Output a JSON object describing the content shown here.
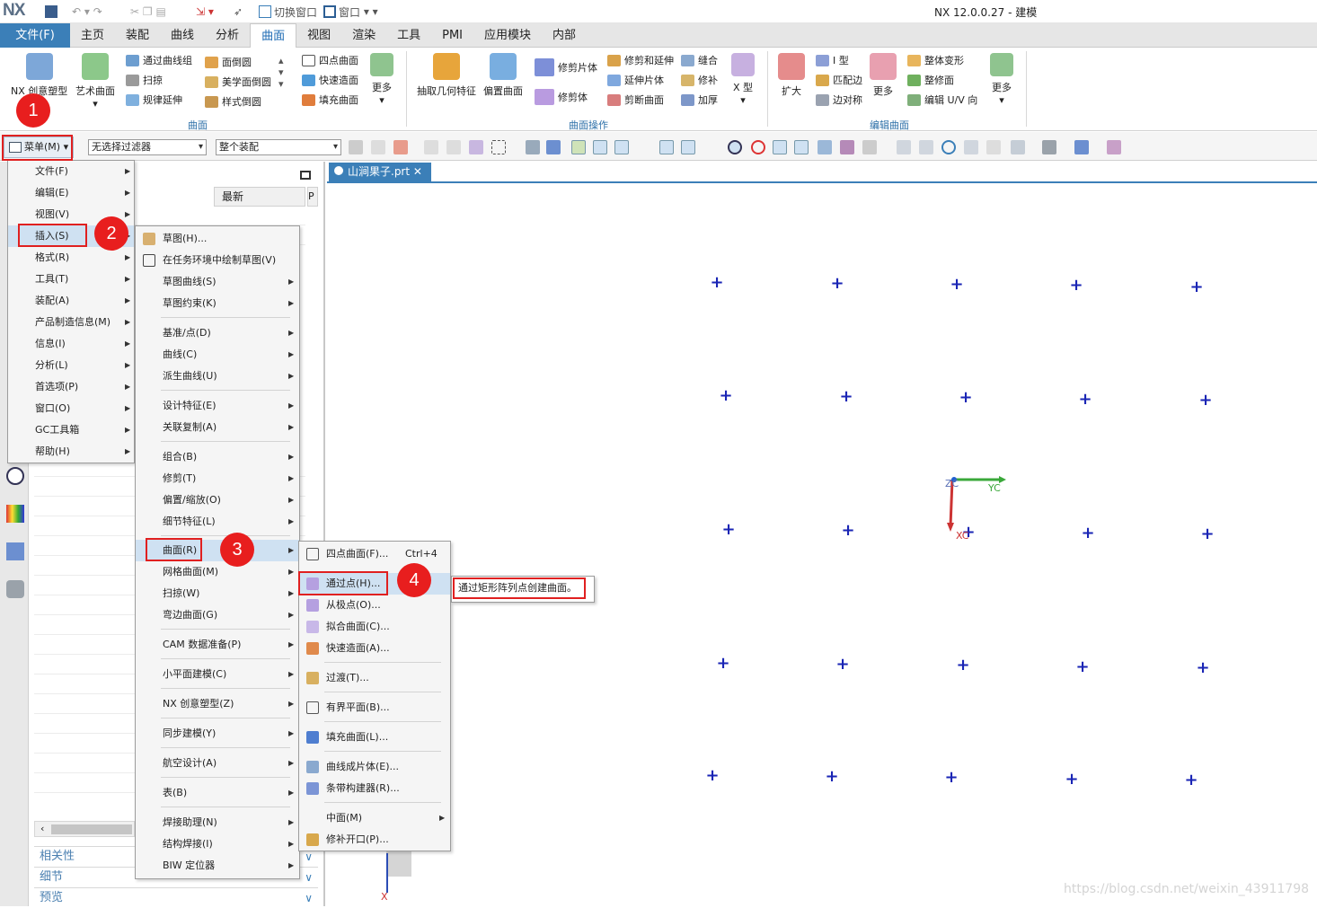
{
  "app": {
    "logo": "NX",
    "window_title": "NX 12.0.0.27 - 建模",
    "quick_access": {
      "switch_window": "切换窗口",
      "window": "窗口"
    }
  },
  "menu_tabs": [
    "文件(F)",
    "主页",
    "装配",
    "曲线",
    "分析",
    "曲面",
    "视图",
    "渲染",
    "工具",
    "PMI",
    "应用模块",
    "内部"
  ],
  "active_tab": "曲面",
  "ribbon": {
    "big": [
      "NX 创意塑型",
      "艺术曲面",
      "更多",
      "抽取几何特征",
      "偏置曲面",
      "X 型",
      "扩大",
      "更多",
      "更多"
    ],
    "col1": [
      "通过曲线组",
      "扫掠",
      "规律延伸"
    ],
    "col2": [
      "面倒圆",
      "美学面倒圆",
      "样式倒圆"
    ],
    "col3": [
      "四点曲面",
      "快速造面",
      "填充曲面"
    ],
    "col4": [
      "修剪片体",
      "修剪体"
    ],
    "col5": [
      "修剪和延伸",
      "延伸片体",
      "剪断曲面"
    ],
    "col6": [
      "缝合",
      "修补",
      "加厚"
    ],
    "col7": [
      "I 型",
      "匹配边",
      "边对称"
    ],
    "col8": [
      "整体变形",
      "整修面",
      "编辑 U/V 向"
    ],
    "groups": [
      "曲面",
      "曲面操作",
      "编辑曲面"
    ]
  },
  "toolbar": {
    "menu_button": "菜单(M)",
    "filter": "无选择过滤器",
    "assembly": "整个装配"
  },
  "nav": {
    "column_latest": "最新",
    "column_p": "P",
    "accordion": [
      "相关性",
      "细节",
      "预览"
    ]
  },
  "viewport": {
    "tab": "山涧果子.prt",
    "axes": {
      "z": "ZC",
      "y": "YC",
      "x": "XC",
      "x2": "X"
    }
  },
  "main_menu": [
    "文件(F)",
    "编辑(E)",
    "视图(V)",
    "插入(S)",
    "格式(R)",
    "工具(T)",
    "装配(A)",
    "产品制造信息(M)",
    "信息(I)",
    "分析(L)",
    "首选项(P)",
    "窗口(O)",
    "GC工具箱",
    "帮助(H)"
  ],
  "insert_menu": [
    "草图(H)...",
    "在任务环境中绘制草图(V)",
    "草图曲线(S)",
    "草图约束(K)",
    "基准/点(D)",
    "曲线(C)",
    "派生曲线(U)",
    "设计特征(E)",
    "关联复制(A)",
    "组合(B)",
    "修剪(T)",
    "偏置/缩放(O)",
    "细节特征(L)",
    "曲面(R)",
    "网格曲面(M)",
    "扫掠(W)",
    "弯边曲面(G)",
    "CAM 数据准备(P)",
    "小平面建模(C)",
    "NX 创意塑型(Z)",
    "同步建模(Y)",
    "航空设计(A)",
    "表(B)",
    "焊接助理(N)",
    "结构焊接(I)",
    "BIW 定位器"
  ],
  "surface_menu": [
    "四点曲面(F)...",
    "通过点(H)...",
    "从极点(O)...",
    "拟合曲面(C)...",
    "快速造面(A)...",
    "过渡(T)...",
    "有界平面(B)...",
    "填充曲面(L)...",
    "曲线成片体(E)...",
    "条带构建器(R)...",
    "中面(M)",
    "修补开口(P)..."
  ],
  "shortcut": "Ctrl+4",
  "tooltip": "通过矩形阵列点创建曲面。",
  "steps": [
    "1",
    "2",
    "3",
    "4"
  ],
  "watermark": "https://blog.csdn.net/weixin_43911798",
  "colors": {
    "accent": "#3b7fb8",
    "marker": "#e81e1e",
    "points": "#1a25b5"
  }
}
